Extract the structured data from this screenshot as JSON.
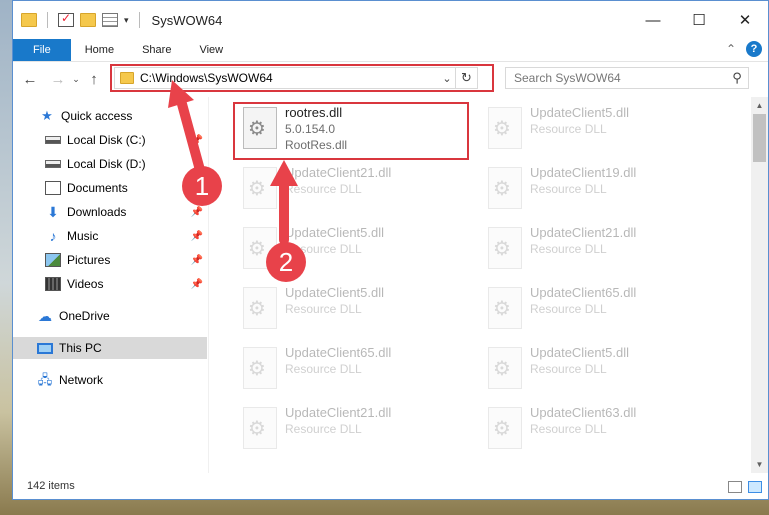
{
  "window": {
    "title": "SysWOW64"
  },
  "title_controls": {
    "minimize": "—",
    "maximize": "☐",
    "close": "✕"
  },
  "ribbon": {
    "tabs": [
      "File",
      "Home",
      "Share",
      "View"
    ],
    "collapse": "⌃",
    "help": "?"
  },
  "nav": {
    "back": "←",
    "forward": "→",
    "recent": "⌄",
    "up": "↑"
  },
  "address": {
    "path": "C:\\Windows\\SysWOW64",
    "dropdown": "⌄",
    "refresh": "↻"
  },
  "search": {
    "placeholder": "Search SysWOW64",
    "icon": "⚲"
  },
  "sidebar": {
    "items": [
      {
        "label": "Quick access",
        "icon": "star-icon",
        "pinned": false
      },
      {
        "label": "Local Disk (C:)",
        "icon": "drive-icon",
        "pinned": true
      },
      {
        "label": "Local Disk (D:)",
        "icon": "drive-icon",
        "pinned": false
      },
      {
        "label": "Documents",
        "icon": "documents-icon",
        "pinned": true
      },
      {
        "label": "Downloads",
        "icon": "download-icon",
        "pinned": true
      },
      {
        "label": "Music",
        "icon": "music-icon",
        "pinned": true
      },
      {
        "label": "Pictures",
        "icon": "pictures-icon",
        "pinned": true
      },
      {
        "label": "Videos",
        "icon": "videos-icon",
        "pinned": true
      },
      {
        "label": "OneDrive",
        "icon": "cloud-icon",
        "pinned": false
      },
      {
        "label": "This PC",
        "icon": "computer-icon",
        "pinned": false,
        "selected": true
      },
      {
        "label": "Network",
        "icon": "network-icon",
        "pinned": false
      }
    ],
    "pin_glyph": "📌"
  },
  "files": [
    {
      "name": "rootres.dll",
      "line2": "5.0.154.0",
      "line3": "RootRes.dll",
      "highlighted": true
    },
    {
      "name": "UpdateClient5.dll",
      "line2": "Resource DLL"
    },
    {
      "name": "UpdateClient21.dll",
      "line2": "Resource DLL"
    },
    {
      "name": "UpdateClient19.dll",
      "line2": "Resource DLL"
    },
    {
      "name": "UpdateClient5.dll",
      "line2": "Resource DLL"
    },
    {
      "name": "UpdateClient21.dll",
      "line2": "Resource DLL"
    },
    {
      "name": "UpdateClient5.dll",
      "line2": "Resource DLL"
    },
    {
      "name": "UpdateClient65.dll",
      "line2": "Resource DLL"
    },
    {
      "name": "UpdateClient65.dll",
      "line2": "Resource DLL"
    },
    {
      "name": "UpdateClient5.dll",
      "line2": "Resource DLL"
    },
    {
      "name": "UpdateClient21.dll",
      "line2": "Resource DLL"
    },
    {
      "name": "UpdateClient63.dll",
      "line2": "Resource DLL"
    }
  ],
  "status": {
    "count": "142 items"
  },
  "annotations": {
    "step1": "1",
    "step2": "2"
  },
  "colors": {
    "accent": "#1979ca",
    "highlight_border": "#d9363e",
    "arrow": "#e8424a"
  }
}
